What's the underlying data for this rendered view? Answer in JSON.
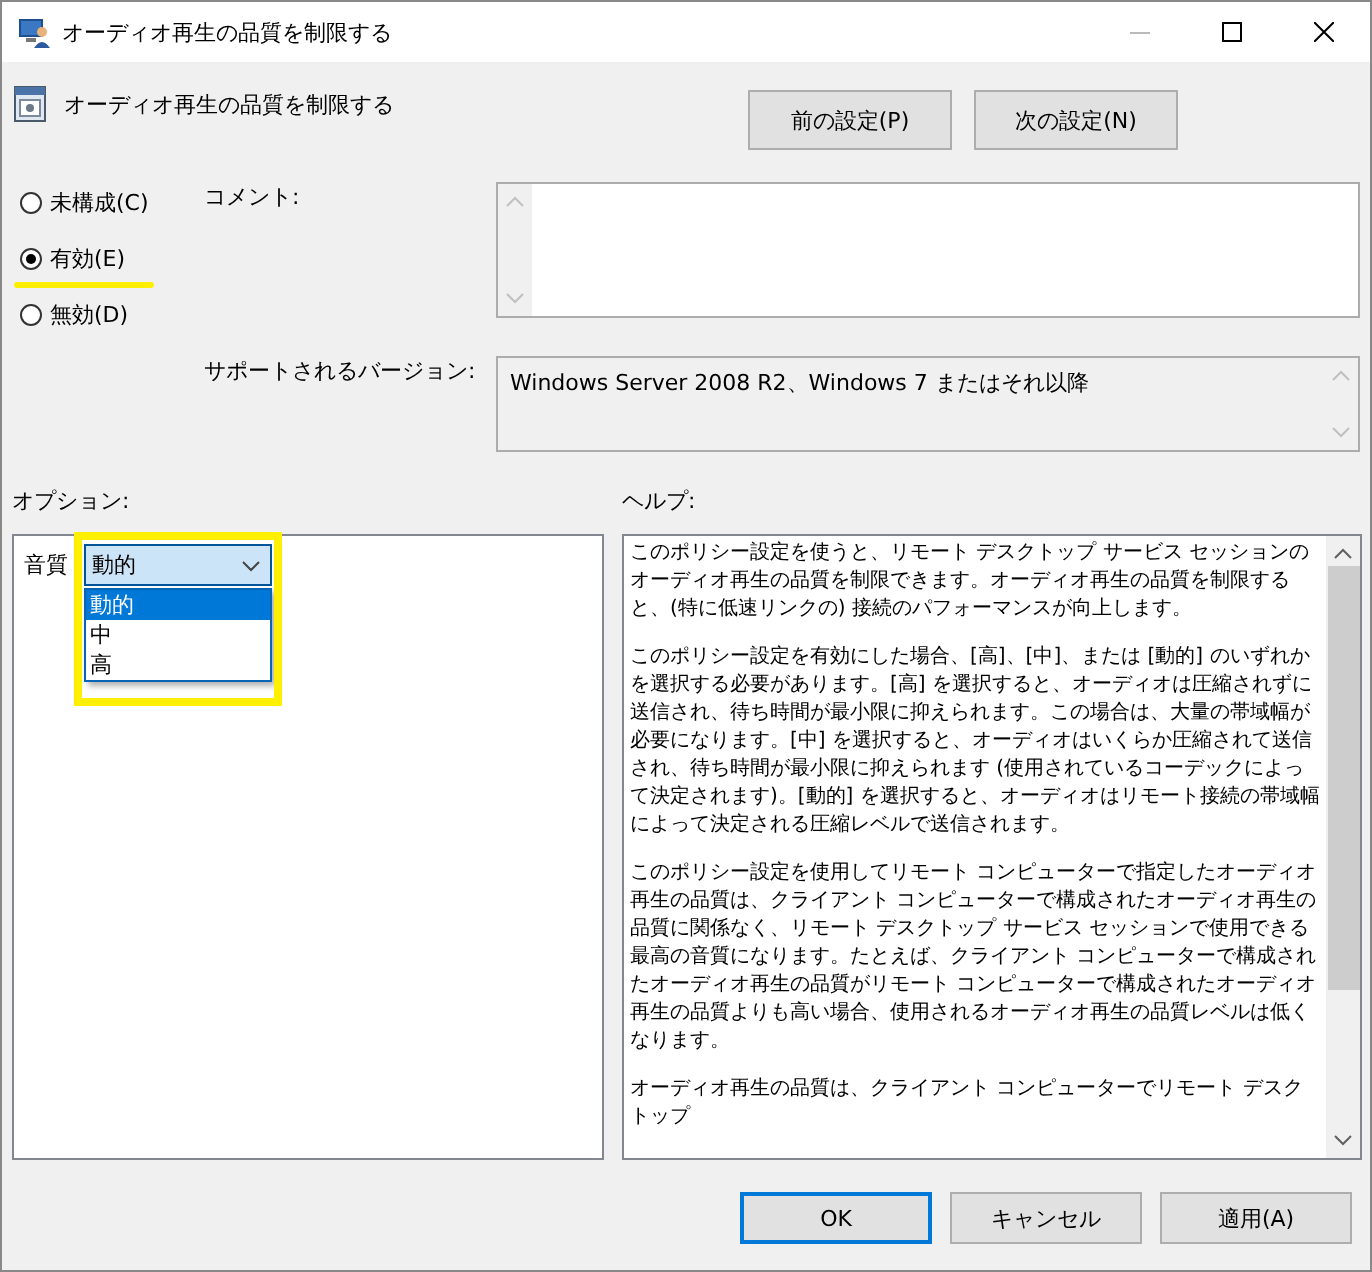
{
  "window": {
    "title": "オーディオ再生の品質を制限する"
  },
  "header": {
    "title": "オーディオ再生の品質を制限する",
    "nav_buttons": [
      "前の設定(P)",
      "次の設定(N)"
    ]
  },
  "state_options": [
    {
      "label": "未構成(C)",
      "selected": false,
      "highlighted": false
    },
    {
      "label": "有効(E)",
      "selected": true,
      "highlighted": true
    },
    {
      "label": "無効(D)",
      "selected": false,
      "highlighted": false
    }
  ],
  "comment": {
    "label": "コメント:"
  },
  "supported": {
    "label": "サポートされるバージョン:",
    "value": "Windows Server 2008 R2、Windows 7 またはそれ以降"
  },
  "options": {
    "label": "オプション:",
    "setting": {
      "label": "音質",
      "dropdown": {
        "value": "動的",
        "open": true,
        "highlighted": true,
        "items": [
          {
            "label": "動的",
            "selected": true
          },
          {
            "label": "中",
            "selected": false
          },
          {
            "label": "高",
            "selected": false
          }
        ]
      }
    }
  },
  "help": {
    "label": "ヘルプ:",
    "paragraphs": [
      "このポリシー設定を使うと、リモート デスクトップ サービス セッションのオーディオ再生の品質を制限できます。オーディオ再生の品質を制限すると、(特に低速リンクの) 接続のパフォーマンスが向上します。",
      "このポリシー設定を有効にした場合、[高]、[中]、または [動的] のいずれかを選択する必要があります。[高] を選択すると、オーディオは圧縮されずに送信され、待ち時間が最小限に抑えられます。この場合は、大量の帯域幅が必要になります。[中] を選択すると、オーディオはいくらか圧縮されて送信され、待ち時間が最小限に抑えられます (使用されているコーデックによって決定されます)。[動的] を選択すると、オーディオはリモート接続の帯域幅によって決定される圧縮レベルで送信されます。",
      "このポリシー設定を使用してリモート コンピューターで指定したオーディオ再生の品質は、クライアント コンピューターで構成されたオーディオ再生の品質に関係なく、リモート デスクトップ サービス セッションで使用できる最高の音質になります。たとえば、クライアント コンピューターで構成されたオーディオ再生の品質がリモート コンピューターで構成されたオーディオ再生の品質よりも高い場合、使用されるオーディオ再生の品質レベルは低くなります。",
      "オーディオ再生の品質は、クライアント コンピューターでリモート デスクトップ"
    ]
  },
  "buttons": [
    {
      "label": "OK",
      "default": true
    },
    {
      "label": "キャンセル",
      "default": false
    },
    {
      "label": "適用(A)",
      "default": false
    }
  ]
}
